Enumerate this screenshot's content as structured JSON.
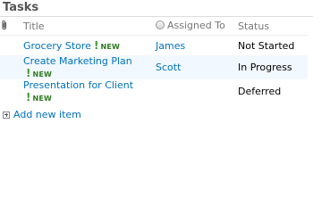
{
  "list": {
    "title": "Tasks"
  },
  "columns": {
    "attachment_icon": "paperclip-icon",
    "title": "Title",
    "assigned_to": "Assigned To",
    "status": "Status"
  },
  "rows": [
    {
      "title": "Grocery Store",
      "badge": "NEW",
      "assigned_to": "James",
      "status": "Not Started"
    },
    {
      "title": "Create Marketing Plan",
      "badge": "NEW",
      "assigned_to": "Scott",
      "status": "In Progress"
    },
    {
      "title": "Presentation for Client",
      "badge": "NEW",
      "assigned_to": "",
      "status": "Deferred"
    }
  ],
  "actions": {
    "add_new_item": "Add new item"
  },
  "colors": {
    "link": "#0072bc",
    "new_badge": "#2d7a1f",
    "alt_row": "#f2f8ff"
  }
}
